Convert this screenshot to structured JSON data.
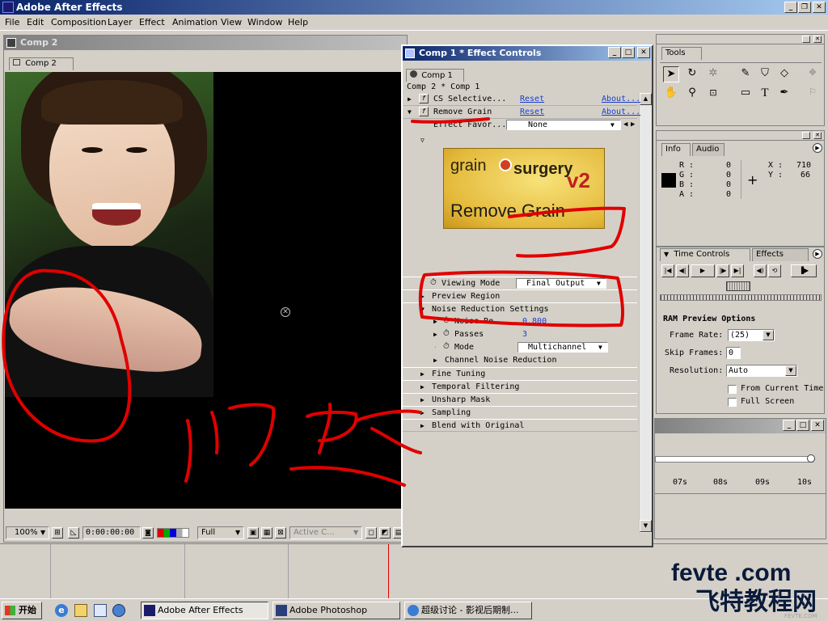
{
  "app": {
    "title": "Adobe After Effects"
  },
  "menu": [
    "File",
    "Edit",
    "Composition",
    "Layer",
    "Effect",
    "Animation",
    "View",
    "Window",
    "Help"
  ],
  "comp_window": {
    "title": "Comp 2",
    "tab": "Comp 2",
    "zoom": "100%",
    "timecode": "0:00:00:00",
    "resolution": "Full",
    "camera": "Active C..."
  },
  "effect_controls": {
    "title": "Comp 1 * Effect Controls",
    "tab": "Comp 1",
    "breadcrumb": "Comp 2 * Comp 1",
    "cs_selective": {
      "label": "CS Selective...",
      "reset": "Reset",
      "about": "About..."
    },
    "remove_grain": {
      "label": "Remove Grain",
      "reset": "Reset",
      "about": "About..."
    },
    "effect_favorites": {
      "label": "Effect Favor...",
      "value": "None"
    },
    "logo": {
      "brand_left": "grain",
      "brand_right": "surgery",
      "version": "v2",
      "caption": "Remove Grain"
    },
    "viewing_mode": {
      "label": "Viewing Mode",
      "value": "Final Output"
    },
    "preview_region": "Preview Region",
    "noise_reduction_settings": "Noise Reduction Settings",
    "noise_reduction": {
      "label": "Noise Re...",
      "value": "0.800"
    },
    "passes": {
      "label": "Passes",
      "value": "3"
    },
    "mode": {
      "label": "Mode",
      "value": "Multichannel"
    },
    "channel_noise_reduction": "Channel Noise Reduction",
    "groups": [
      "Fine Tuning",
      "Temporal Filtering",
      "Unsharp Mask",
      "Sampling",
      "Blend with Original"
    ]
  },
  "tools": {
    "title": "Tools"
  },
  "info": {
    "tabs": [
      "Info",
      "Audio"
    ],
    "r": "0",
    "g": "0",
    "b": "0",
    "a": "0",
    "x": "710",
    "y": "66",
    "labels": {
      "r": "R :",
      "g": "G :",
      "b": "B :",
      "a": "A :",
      "x": "X :",
      "y": "Y :"
    }
  },
  "time_controls": {
    "tabs": [
      "Time Controls",
      "Effects"
    ],
    "ram_preview_title": "RAM Preview Options",
    "frame_rate_label": "Frame Rate:",
    "frame_rate": "(25)",
    "skip_frames_label": "Skip Frames:",
    "skip_frames": "0",
    "resolution_label": "Resolution:",
    "resolution": "Auto",
    "from_current_time": "From Current Time",
    "full_screen": "Full Screen"
  },
  "timeline": {
    "ticks": [
      "07s",
      "08s",
      "09s",
      "10s"
    ]
  },
  "annotation": {
    "handwriting": "问题"
  },
  "watermark": {
    "domain": "fevte .com",
    "cn": "飞特教程网",
    "small": "FEVTE.COM"
  },
  "taskbar": {
    "start": "开始",
    "items": [
      "Adobe After Effects",
      "Adobe Photoshop",
      "超级讨论 - 影视后期制..."
    ]
  },
  "colors": {
    "accent_red": "#e00000",
    "caption_dark": "#0a246a",
    "caption_light": "#a6caf0",
    "link": "#1a3fd0"
  }
}
